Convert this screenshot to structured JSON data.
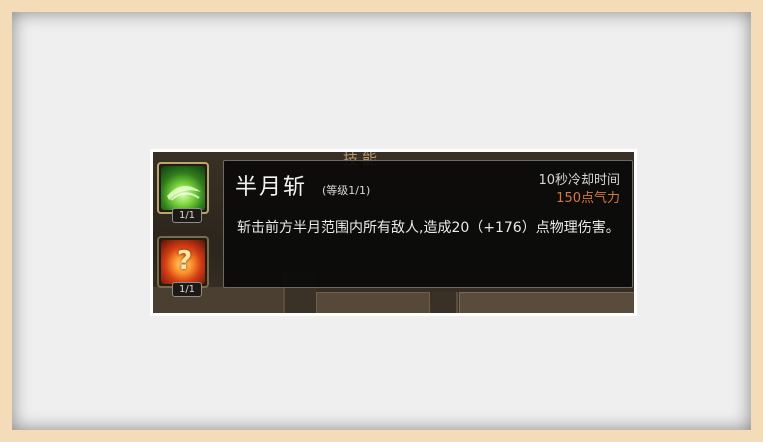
{
  "header": {
    "title": "技能"
  },
  "slots": [
    {
      "icon": "crescent-slash-icon",
      "count": "1/1"
    },
    {
      "icon": "locked-fire-skill-icon",
      "mystery": "?",
      "count": "1/1"
    }
  ],
  "tooltip": {
    "name": "半月斩",
    "level": "(等级1/1)",
    "cooldown": "10秒冷却时间",
    "cost": "150点气力",
    "description": "斩击前方半月范围内所有敌人,造成20（+176）点物理伤害。"
  },
  "colors": {
    "cost": "#d6793f",
    "tooltip_bg": "#0a0a0a",
    "slot_border": "#7c6a47"
  }
}
